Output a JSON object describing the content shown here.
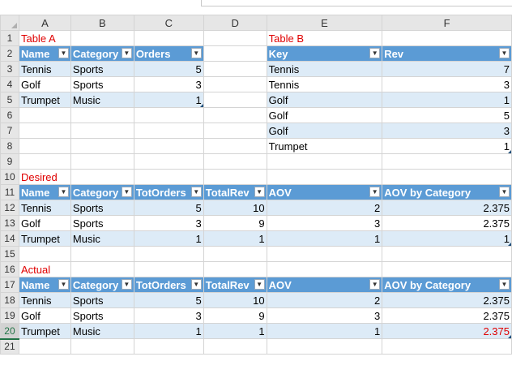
{
  "columns": [
    "A",
    "B",
    "C",
    "D",
    "E",
    "F"
  ],
  "row_numbers": [
    1,
    2,
    3,
    4,
    5,
    6,
    7,
    8,
    9,
    10,
    11,
    12,
    13,
    14,
    15,
    16,
    17,
    18,
    19,
    20,
    21
  ],
  "table_a": {
    "title": "Table A",
    "headers": [
      "Name",
      "Category",
      "Orders"
    ],
    "rows": [
      [
        "Tennis",
        "Sports",
        "5"
      ],
      [
        "Golf",
        "Sports",
        "3"
      ],
      [
        "Trumpet",
        "Music",
        "1"
      ]
    ]
  },
  "table_b": {
    "title": "Table B",
    "headers": [
      "Key",
      "Rev"
    ],
    "rows": [
      [
        "Tennis",
        "7"
      ],
      [
        "Tennis",
        "3"
      ],
      [
        "Golf",
        "1"
      ],
      [
        "Golf",
        "5"
      ],
      [
        "Golf",
        "3"
      ],
      [
        "Trumpet",
        "1"
      ]
    ]
  },
  "desired": {
    "title": "Desired",
    "headers": [
      "Name",
      "Category",
      "TotOrders",
      "TotalRev",
      "AOV",
      "AOV by Category"
    ],
    "rows": [
      [
        "Tennis",
        "Sports",
        "5",
        "10",
        "2",
        "2.375"
      ],
      [
        "Golf",
        "Sports",
        "3",
        "9",
        "3",
        "2.375"
      ],
      [
        "Trumpet",
        "Music",
        "1",
        "1",
        "1",
        "1"
      ]
    ]
  },
  "actual": {
    "title": "Actual",
    "headers": [
      "Name",
      "Category",
      "TotOrders",
      "TotalRev",
      "AOV",
      "AOV by Category"
    ],
    "rows": [
      [
        "Tennis",
        "Sports",
        "5",
        "10",
        "2",
        "2.375"
      ],
      [
        "Golf",
        "Sports",
        "3",
        "9",
        "3",
        "2.375"
      ],
      [
        "Trumpet",
        "Music",
        "1",
        "1",
        "1",
        "2.375"
      ]
    ]
  },
  "colors": {
    "header_blue": "#5b9bd5",
    "band_blue": "#ddebf7",
    "title_red": "#e00000",
    "excel_green": "#217346"
  },
  "icons": {
    "filter": "filter-dropdown-icon"
  }
}
